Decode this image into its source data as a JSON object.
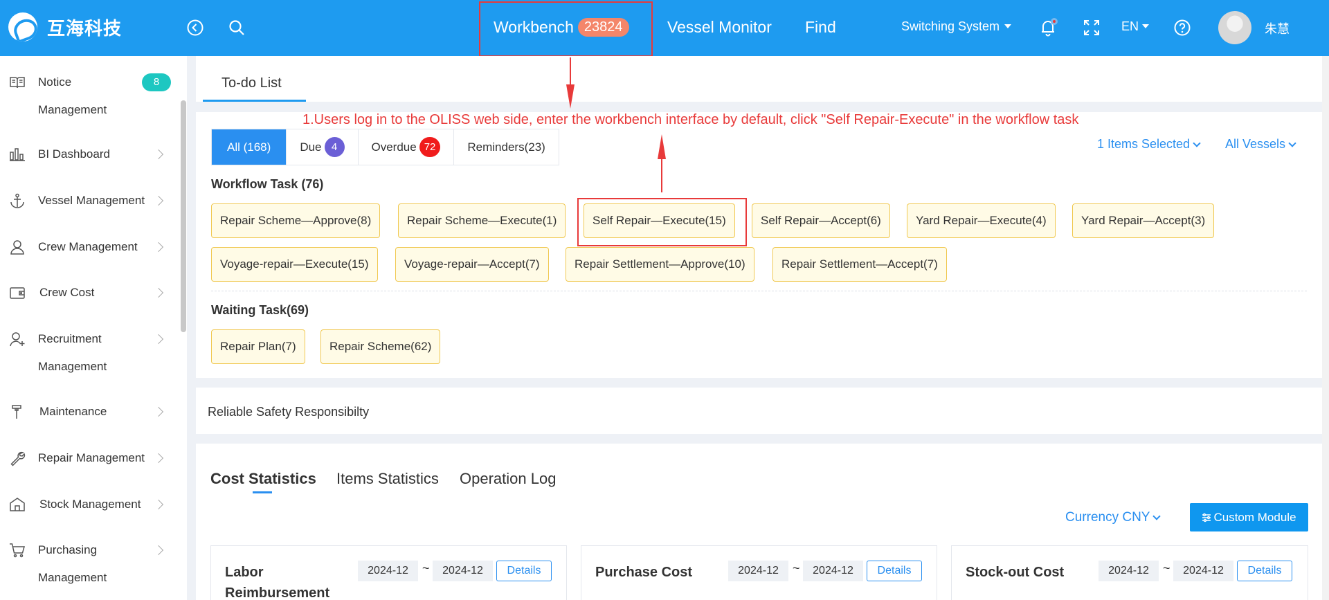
{
  "header": {
    "brand": "互海科技",
    "nav": {
      "workbench": "Workbench",
      "workbench_count": "23824",
      "vessel_monitor": "Vessel Monitor",
      "find": "Find"
    },
    "switching_system": "Switching System",
    "language": "EN",
    "user_name": "朱慧"
  },
  "sidebar": {
    "items": [
      {
        "line1": "Notice",
        "line2": "Management",
        "badge": "8"
      },
      {
        "line1": "BI Dashboard"
      },
      {
        "line1": "Vessel Management"
      },
      {
        "line1": "Crew Management"
      },
      {
        "line1": "Crew Cost"
      },
      {
        "line1": "Recruitment",
        "line2": "Management"
      },
      {
        "line1": "Maintenance"
      },
      {
        "line1": "Repair Management"
      },
      {
        "line1": "Stock Management"
      },
      {
        "line1": "Purchasing",
        "line2": "Management"
      }
    ]
  },
  "todo": {
    "tab_label": "To-do List",
    "annotation": "1.Users log in to the OLISS web side, enter the workbench interface by default, click \"Self Repair-Execute\" in the workflow task",
    "filters": {
      "all": "All (168)",
      "due": "Due",
      "due_count": "4",
      "overdue": "Overdue",
      "overdue_count": "72",
      "reminders": "Reminders(23)"
    },
    "items_selected": "1 Items Selected",
    "all_vessels": "All Vessels",
    "workflow_title": "Workflow Task (76)",
    "workflow_tasks": [
      "Repair Scheme—Approve(8)",
      "Repair Scheme—Execute(1)",
      "Self Repair—Execute(15)",
      "Self Repair—Accept(6)",
      "Yard Repair—Execute(4)",
      "Yard Repair—Accept(3)",
      "Voyage-repair—Execute(15)",
      "Voyage-repair—Accept(7)",
      "Repair Settlement—Approve(10)",
      "Repair Settlement—Accept(7)"
    ],
    "waiting_title": "Waiting Task(69)",
    "waiting_tasks": [
      "Repair Plan(7)",
      "Repair Scheme(62)"
    ]
  },
  "reliable": "Reliable Safety Responsibilty",
  "statistics": {
    "tabs": [
      "Cost Statistics",
      "Items Statistics",
      "Operation Log"
    ],
    "currency": "Currency CNY",
    "custom_module": "Custom Module",
    "cards": [
      {
        "title": "Labor Reimbursement",
        "from": "2024-12",
        "to": "2024-12",
        "details": "Details"
      },
      {
        "title": "Purchase Cost",
        "from": "2024-12",
        "to": "2024-12",
        "details": "Details"
      },
      {
        "title": "Stock-out Cost",
        "from": "2024-12",
        "to": "2024-12",
        "details": "Details"
      }
    ],
    "tilde": "~"
  },
  "colors": {
    "header_bg": "#1e9bf0",
    "accent": "#2a8ff0",
    "annotation_red": "#e83a3a",
    "due_badge": "#6b5fd6",
    "overdue_badge": "#f01c1c",
    "notice_badge": "#1dc7c1",
    "workbench_badge": "#f4866a"
  }
}
